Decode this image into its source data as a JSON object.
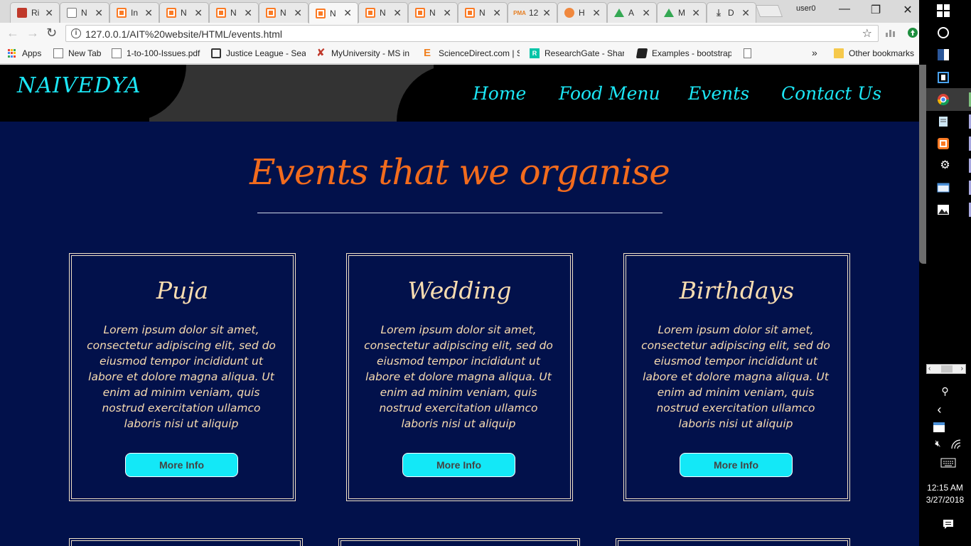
{
  "browser": {
    "tabs": [
      {
        "title": "Ri",
        "icon": "profile-icon"
      },
      {
        "title": "N",
        "icon": "doc-icon"
      },
      {
        "title": "In",
        "icon": "xampp-icon"
      },
      {
        "title": "N",
        "icon": "xampp-icon"
      },
      {
        "title": "N",
        "icon": "xampp-icon"
      },
      {
        "title": "N",
        "icon": "xampp-icon"
      },
      {
        "title": "N",
        "icon": "xampp-icon"
      },
      {
        "title": "N",
        "icon": "xampp-icon"
      },
      {
        "title": "N",
        "icon": "xampp-icon"
      },
      {
        "title": "N",
        "icon": "xampp-icon"
      },
      {
        "title": "12",
        "icon": "phpmyadmin-icon"
      },
      {
        "title": "H",
        "icon": "orange-round-icon"
      },
      {
        "title": "A",
        "icon": "drive-icon"
      },
      {
        "title": "M",
        "icon": "drive-icon"
      },
      {
        "title": "D",
        "icon": "download-icon"
      }
    ],
    "active_tab": 6,
    "profile": "user0",
    "url": "127.0.0.1/AIT%20website/HTML/events.html",
    "bookmarks": [
      {
        "label": "Apps"
      },
      {
        "label": "New Tab"
      },
      {
        "label": "1-to-100-Issues.pdf"
      },
      {
        "label": "Justice League - Seas"
      },
      {
        "label": "MyUniversity - MS in"
      },
      {
        "label": "ScienceDirect.com | S"
      },
      {
        "label": "ResearchGate - Share"
      },
      {
        "label": "Examples - bootstrap"
      }
    ],
    "overflow": "»",
    "other_bookmarks": "Other bookmarks"
  },
  "site": {
    "brand": "NAIVEDYA",
    "nav": [
      "Home",
      "Food Menu",
      "Events",
      "Contact Us"
    ],
    "section_title": "Events that we organise",
    "cards": [
      {
        "title": "Puja",
        "text": "Lorem ipsum dolor sit amet, consectetur adipiscing elit, sed do eiusmod tempor incididunt ut labore et dolore magna aliqua. Ut enim ad minim veniam, quis nostrud exercitation ullamco laboris nisi ut aliquip",
        "button": "More Info"
      },
      {
        "title": "Wedding",
        "text": "Lorem ipsum dolor sit amet, consectetur adipiscing elit, sed do eiusmod tempor incididunt ut labore et dolore magna aliqua. Ut enim ad minim veniam, quis nostrud exercitation ullamco laboris nisi ut aliquip",
        "button": "More Info"
      },
      {
        "title": "Birthdays",
        "text": "Lorem ipsum dolor sit amet, consectetur adipiscing elit, sed do eiusmod tempor incididunt ut labore et dolore magna aliqua. Ut enim ad minim veniam, quis nostrud exercitation ullamco laboris nisi ut aliquip",
        "button": "More Info"
      }
    ],
    "colors": {
      "background": "#02114b",
      "accent": "#1ce6f5",
      "title": "#f26b1d",
      "card_text": "#f8dcb0"
    }
  },
  "taskbar": {
    "time": "12:15 AM",
    "date": "3/27/2018"
  }
}
